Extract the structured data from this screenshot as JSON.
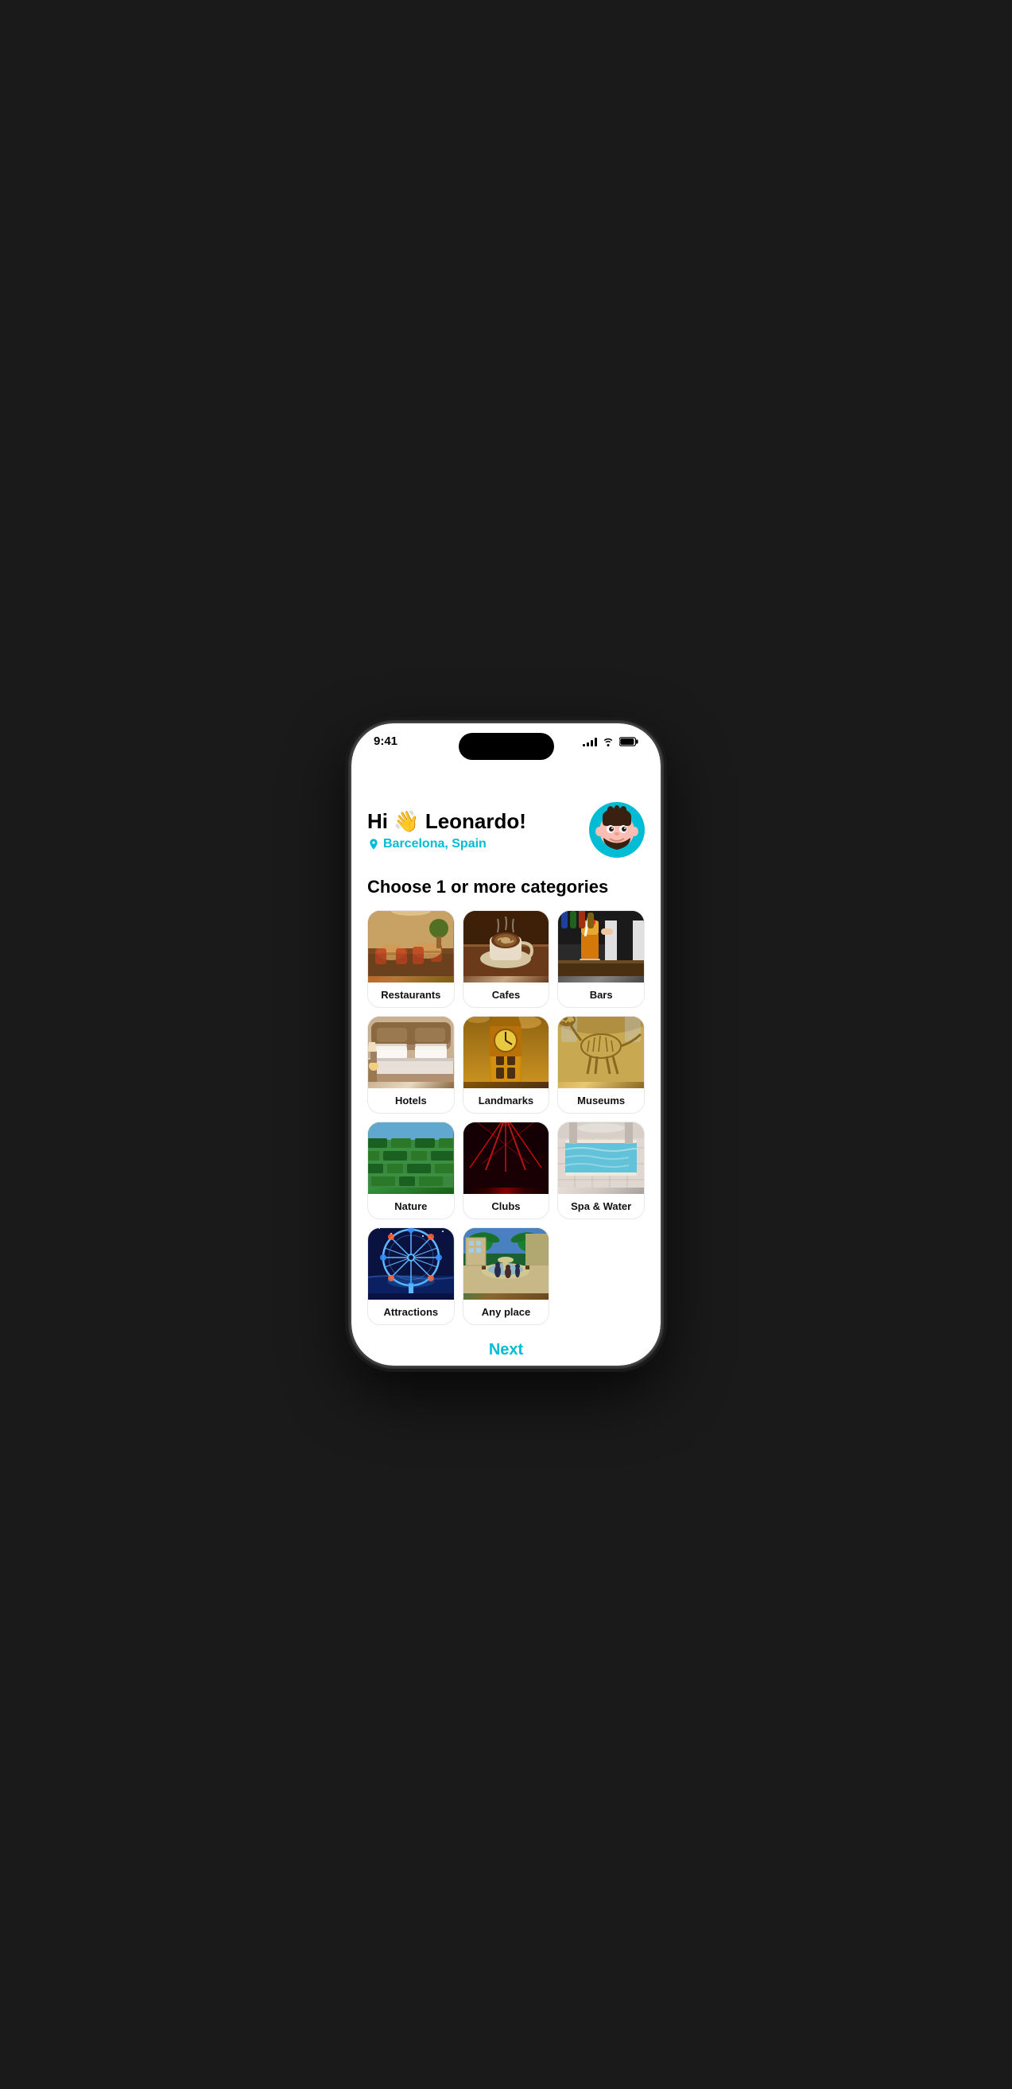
{
  "statusBar": {
    "time": "9:41",
    "signalBars": [
      3,
      5,
      7,
      9,
      11
    ],
    "wifi": "wifi",
    "battery": "battery"
  },
  "header": {
    "greeting": "Hi 👋 Leonardo!",
    "location": "Barcelona, Spain",
    "avatarEmoji": "🧔"
  },
  "sectionTitle": "Choose 1 or more categories",
  "categories": [
    {
      "id": "restaurants",
      "label": "Restaurants",
      "imgClass": "img-restaurants"
    },
    {
      "id": "cafes",
      "label": "Cafes",
      "imgClass": "img-cafes"
    },
    {
      "id": "bars",
      "label": "Bars",
      "imgClass": "img-bars"
    },
    {
      "id": "hotels",
      "label": "Hotels",
      "imgClass": "img-hotels"
    },
    {
      "id": "landmarks",
      "label": "Landmarks",
      "imgClass": "img-landmarks"
    },
    {
      "id": "museums",
      "label": "Museums",
      "imgClass": "img-museums"
    },
    {
      "id": "nature",
      "label": "Nature",
      "imgClass": "img-nature"
    },
    {
      "id": "clubs",
      "label": "Clubs",
      "imgClass": "img-clubs"
    },
    {
      "id": "spa",
      "label": "Spa & Water",
      "imgClass": "img-spa"
    },
    {
      "id": "attractions",
      "label": "Attractions",
      "imgClass": "img-attractions"
    },
    {
      "id": "anyplace",
      "label": "Any place",
      "imgClass": "img-anyplace"
    }
  ],
  "nextButton": {
    "label": "Next"
  },
  "bottomNav": {
    "items": [
      {
        "id": "home",
        "icon": "home",
        "active": false
      },
      {
        "id": "explore",
        "icon": "compass",
        "active": false
      },
      {
        "id": "saved",
        "icon": "bookmark",
        "active": false
      },
      {
        "id": "profile",
        "icon": "user",
        "active": false
      }
    ]
  }
}
